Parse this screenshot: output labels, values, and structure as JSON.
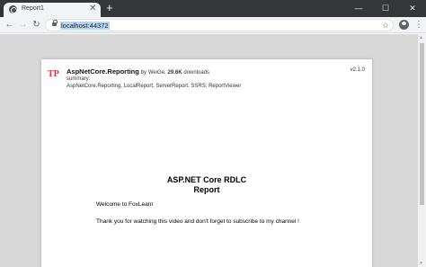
{
  "browser": {
    "tab": {
      "title": "Report1",
      "close_glyph": "✕"
    },
    "new_tab_glyph": "+",
    "window_controls": {
      "minimize": "—",
      "maximize": "☐",
      "close": "✕"
    },
    "nav": {
      "back": "←",
      "forward": "→",
      "reload": "↻"
    },
    "address_bar": {
      "url": "localhost:44372",
      "bookmark_glyph": "☆"
    },
    "menu_glyph": "⋮"
  },
  "report": {
    "package": {
      "name": "AspNetCore.Reporting",
      "by": "by",
      "author": "WeiGe,",
      "downloads": "29.6K",
      "downloads_label": "downloads",
      "summary_label": "summary:",
      "summary": "AspNetCore.Reporting, LocalReport, ServerReport, SSRS, ReportViewer",
      "version": "v2.1.0",
      "logo_text": "TP"
    },
    "title_line1": "ASP.NET Core RDLC",
    "title_line2": "Report",
    "welcome": "Welcome to FoxLearn",
    "thanks": "Thank you for watching this video and don't forget to subscribe to my channel !"
  },
  "colors": {
    "tabstrip": "#35363a",
    "toolbar": "#f1f3f4",
    "url_highlight": "#b6d7fb",
    "logo": "#e0323a",
    "viewport_bg": "#d8d8d8"
  }
}
